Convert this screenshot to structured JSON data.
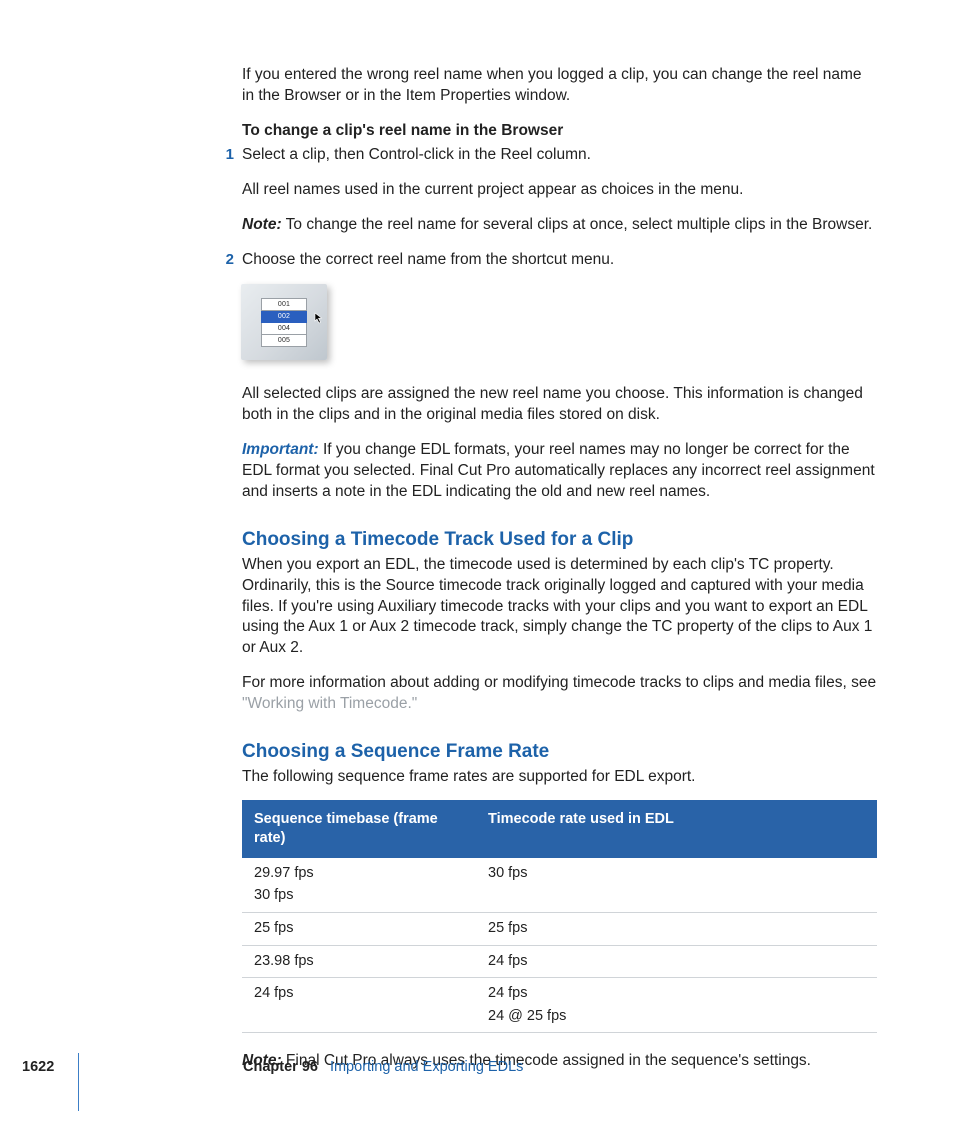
{
  "intro_para": "If you entered the wrong reel name when you logged a clip, you can change the reel name in the Browser or in the Item Properties window.",
  "procedure_heading": "To change a clip's reel name in the Browser",
  "steps": {
    "s1": {
      "num": "1",
      "text": "Select a clip, then Control-click in the Reel column.",
      "follow1": "All reel names used in the current project appear as choices in the menu.",
      "note_label": "Note:",
      "note_text": "  To change the reel name for several clips at once, select multiple clips in the Browser."
    },
    "s2": {
      "num": "2",
      "text": "Choose the correct reel name from the shortcut menu."
    }
  },
  "menu": {
    "items": [
      "001",
      "002",
      "004",
      "005"
    ],
    "selected_index": 1
  },
  "after_menu_para": "All selected clips are assigned the new reel name you choose. This information is changed both in the clips and in the original media files stored on disk.",
  "important": {
    "label": "Important:",
    "text": "  If you change EDL formats, your reel names may no longer be correct for the EDL format you selected. Final Cut Pro automatically replaces any incorrect reel assignment and inserts a note in the EDL indicating the old and new reel names."
  },
  "section1": {
    "heading": "Choosing a Timecode Track Used for a Clip",
    "para1": "When you export an EDL, the timecode used is determined by each clip's TC property. Ordinarily, this is the Source timecode track originally logged and captured with your media files. If you're using Auxiliary timecode tracks with your clips and you want to export an EDL using the Aux 1 or Aux 2 timecode track, simply change the TC property of the clips to Aux 1 or Aux 2.",
    "para2a": "For more information about adding or modifying timecode tracks to clips and media files, see ",
    "para2b": "\"Working with Timecode.\""
  },
  "section2": {
    "heading": "Choosing a Sequence Frame Rate",
    "intro": "The following sequence frame rates are supported for EDL export.",
    "table": {
      "head_col1": "Sequence timebase (frame rate)",
      "head_col2": "Timecode rate used in EDL",
      "rows": [
        {
          "c1a": "29.97 fps",
          "c1b": "30 fps",
          "c2a": "30 fps",
          "c2b": ""
        },
        {
          "c1a": "25 fps",
          "c1b": "",
          "c2a": "25 fps",
          "c2b": ""
        },
        {
          "c1a": "23.98 fps",
          "c1b": "",
          "c2a": "24 fps",
          "c2b": ""
        },
        {
          "c1a": "24 fps",
          "c1b": "",
          "c2a": "24 fps",
          "c2b": "24 @ 25 fps"
        }
      ]
    },
    "final_note_label": "Note:",
    "final_note_text": "  Final Cut Pro always uses the timecode assigned in the sequence's settings."
  },
  "footer": {
    "page_number": "1622",
    "chapter_strong": "Chapter 96",
    "chapter_title": "Importing and Exporting EDLs"
  }
}
